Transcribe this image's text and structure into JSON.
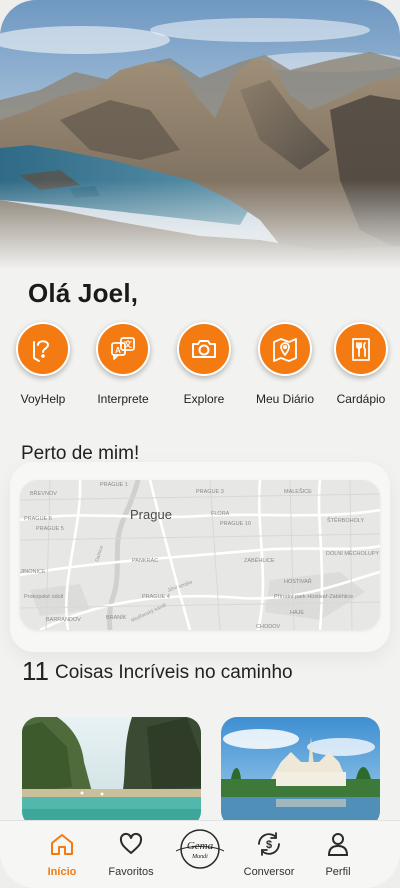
{
  "greeting": "Olá Joel,",
  "accent_color": "#f47a12",
  "actions": [
    {
      "label": "VoyHelp",
      "icon": "help-bubble-icon"
    },
    {
      "label": "Interprete",
      "icon": "translate-icon"
    },
    {
      "label": "Explore",
      "icon": "camera-icon"
    },
    {
      "label": "Meu Diário",
      "icon": "map-pin-icon"
    },
    {
      "label": "Cardápio",
      "icon": "menu-cutlery-icon"
    }
  ],
  "nearby": {
    "title": "Perto de mim!",
    "map": {
      "city": "Prague",
      "labels": [
        "BŘEVNOV",
        "PRAGUE 1",
        "PRAGUE 3",
        "MALEŠICE",
        "PRAGUE 6",
        "PRAGUE 5",
        "FLORA",
        "PRAGUE 10",
        "ŠTĚRBOHOLY",
        "JINONICE",
        "PANKRÁC",
        "ZÁBĚHLICE",
        "DOLNÍ MĚCHOLUPY",
        "HOSTIVAŘ",
        "PRAGUE 4",
        "Prokopské údolí",
        "Přírodní park Hostivař-Záběhlice",
        "HÁJE",
        "BARRANDOV",
        "BRANÍK",
        "CHODOV",
        "Dalnice",
        "Jižní spojka",
        "Modřanský kanál"
      ]
    }
  },
  "things": {
    "count": "11",
    "title": "Coisas Incríveis no caminho"
  },
  "nav": [
    {
      "label": "Início",
      "icon": "home-icon",
      "active": true
    },
    {
      "label": "Favoritos",
      "icon": "heart-icon",
      "active": false
    },
    {
      "label": "",
      "icon": "gema-mundi-logo-icon",
      "active": false,
      "logo_text": "Gema",
      "logo_sub": "Mundi"
    },
    {
      "label": "Conversor",
      "icon": "currency-converter-icon",
      "active": false
    },
    {
      "label": "Perfil",
      "icon": "profile-icon",
      "active": false
    }
  ]
}
